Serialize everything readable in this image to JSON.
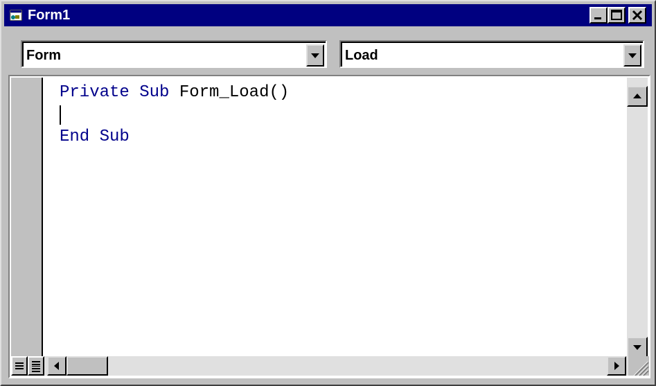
{
  "window": {
    "title": "Form1",
    "icon": "form-icon",
    "controls": [
      "minimize-icon",
      "maximize-icon",
      "close-icon"
    ]
  },
  "object_combo": {
    "value": "Form",
    "icon": "chevron-down-icon"
  },
  "procedure_combo": {
    "value": "Load",
    "icon": "chevron-down-icon"
  },
  "code": {
    "line1": {
      "kw1": "Private Sub",
      "name": "Form_Load()"
    },
    "line3": {
      "kw": "End Sub"
    }
  },
  "colors": {
    "titlebar": "#000080",
    "keyword": "#00008b",
    "face": "#c0c0c0"
  },
  "view_buttons": [
    "procedure-view-icon",
    "full-module-view-icon"
  ]
}
